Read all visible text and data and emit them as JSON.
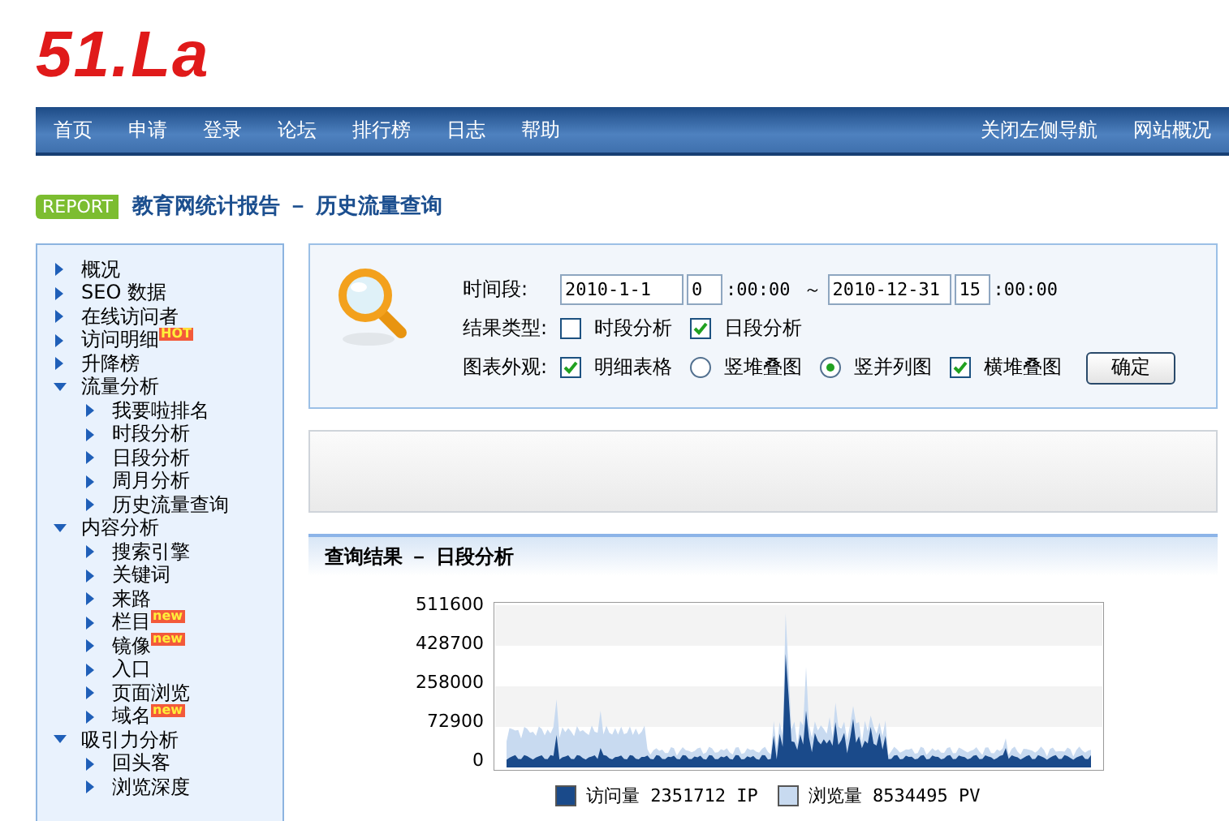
{
  "logo": {
    "text": "51.La"
  },
  "nav": {
    "left": [
      {
        "label": "首页"
      },
      {
        "label": "申请"
      },
      {
        "label": "登录"
      },
      {
        "label": "论坛"
      },
      {
        "label": "排行榜"
      },
      {
        "label": "日志"
      },
      {
        "label": "帮助"
      }
    ],
    "right": [
      {
        "label": "关闭左侧导航"
      },
      {
        "label": "网站概况"
      }
    ]
  },
  "report": {
    "tag": "REPORT",
    "title": "教育网统计报告 － 历史流量查询"
  },
  "sidebar": {
    "items": [
      {
        "label": "概况",
        "expanded": false
      },
      {
        "label": "SEO 数据",
        "expanded": false
      },
      {
        "label": "在线访问者",
        "expanded": false
      },
      {
        "label": "访问明细",
        "badge": "HOT",
        "expanded": false
      },
      {
        "label": "升降榜",
        "expanded": false
      },
      {
        "label": "流量分析",
        "expanded": true,
        "children": [
          {
            "label": "我要啦排名"
          },
          {
            "label": "时段分析"
          },
          {
            "label": "日段分析"
          },
          {
            "label": "周月分析"
          },
          {
            "label": "历史流量查询"
          }
        ]
      },
      {
        "label": "内容分析",
        "expanded": true,
        "children": [
          {
            "label": "搜索引擎"
          },
          {
            "label": "关键词"
          },
          {
            "label": "来路"
          },
          {
            "label": "栏目",
            "badge": "new"
          },
          {
            "label": "镜像",
            "badge": "new"
          },
          {
            "label": "入口"
          },
          {
            "label": "页面浏览"
          },
          {
            "label": "域名",
            "badge": "new"
          }
        ]
      },
      {
        "label": "吸引力分析",
        "expanded": true,
        "children": [
          {
            "label": "回头客"
          },
          {
            "label": "浏览深度"
          }
        ]
      }
    ]
  },
  "query": {
    "period_label": "时间段:",
    "start_date": "2010-1-1",
    "start_hour": "0",
    "start_rest": ":00:00",
    "tilde": "～",
    "end_date": "2010-12-31",
    "end_hour": "15",
    "end_rest": ":00:00",
    "type_label": "结果类型:",
    "types": [
      {
        "label": "时段分析",
        "checked": false
      },
      {
        "label": "日段分析",
        "checked": true
      }
    ],
    "view_label": "图表外观:",
    "views": [
      {
        "kind": "checkbox",
        "label": "明细表格",
        "checked": true
      },
      {
        "kind": "radio",
        "label": "竖堆叠图",
        "selected": false
      },
      {
        "kind": "radio",
        "label": "竖并列图",
        "selected": true
      },
      {
        "kind": "checkbox",
        "label": "横堆叠图",
        "checked": true
      }
    ],
    "submit": "确定"
  },
  "results": {
    "title": "查询结果 － 日段分析",
    "y_tick_labels": [
      "511600",
      "428700",
      "258000",
      "72900",
      "0"
    ],
    "legend": [
      {
        "label": "访问量 2351712 IP",
        "color": "#1a4a8a"
      },
      {
        "label": "浏览量 8534495 PV",
        "color": "#c8daf0"
      }
    ]
  }
}
